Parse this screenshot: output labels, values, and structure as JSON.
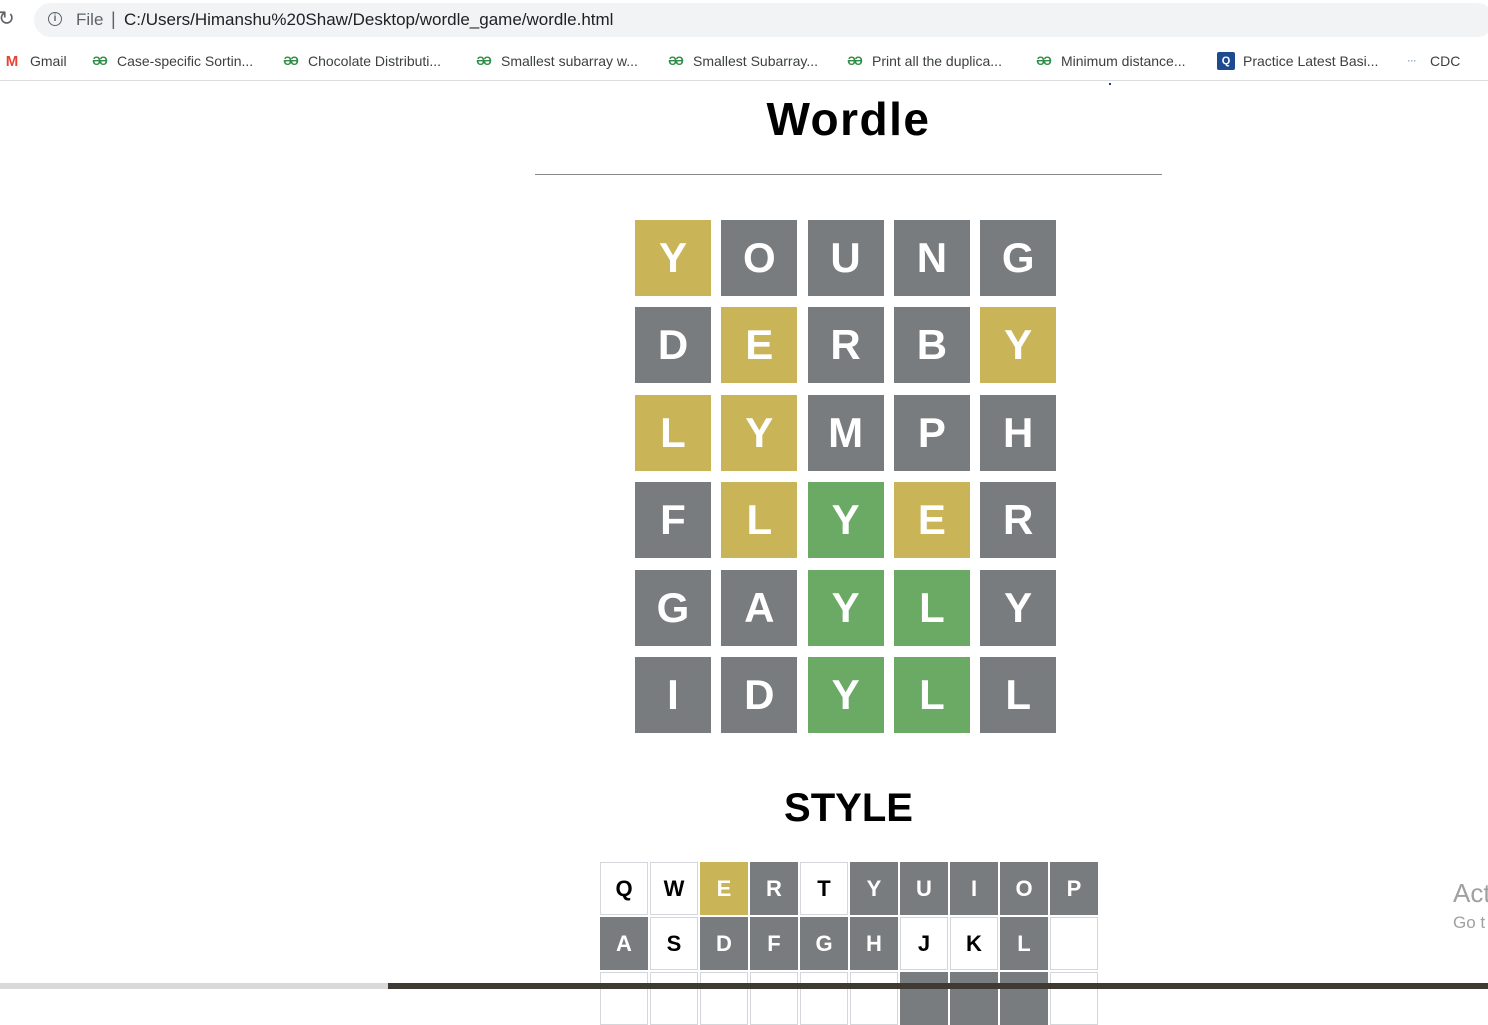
{
  "browser": {
    "file_label": "File",
    "separator": "|",
    "url": "C:/Users/Himanshu%20Shaw/Desktop/wordle_game/wordle.html",
    "bookmarks": [
      {
        "label": "Gmail",
        "icon": "gmail-icon"
      },
      {
        "label": "Case-specific Sortin...",
        "icon": "geeksforgeeks-icon"
      },
      {
        "label": "Chocolate Distributi...",
        "icon": "geeksforgeeks-icon"
      },
      {
        "label": "Smallest subarray w...",
        "icon": "geeksforgeeks-icon"
      },
      {
        "label": "Smallest Subarray...",
        "icon": "geeksforgeeks-icon"
      },
      {
        "label": "Print all the duplica...",
        "icon": "geeksforgeeks-icon"
      },
      {
        "label": "Minimum distance...",
        "icon": "geeksforgeeks-icon"
      },
      {
        "label": "Practice Latest Basi...",
        "icon": "practice-icon"
      },
      {
        "label": "CDC",
        "icon": "cdc-icon"
      }
    ]
  },
  "page": {
    "title": "Wordle",
    "answer": "STYLE"
  },
  "colors": {
    "absent": "#787c7e",
    "present": "#c9b458",
    "correct": "#6aaa64"
  },
  "board": [
    [
      {
        "l": "Y",
        "s": "present"
      },
      {
        "l": "O",
        "s": "absent"
      },
      {
        "l": "U",
        "s": "absent"
      },
      {
        "l": "N",
        "s": "absent"
      },
      {
        "l": "G",
        "s": "absent"
      }
    ],
    [
      {
        "l": "D",
        "s": "absent"
      },
      {
        "l": "E",
        "s": "present"
      },
      {
        "l": "R",
        "s": "absent"
      },
      {
        "l": "B",
        "s": "absent"
      },
      {
        "l": "Y",
        "s": "present"
      }
    ],
    [
      {
        "l": "L",
        "s": "present"
      },
      {
        "l": "Y",
        "s": "present"
      },
      {
        "l": "M",
        "s": "absent"
      },
      {
        "l": "P",
        "s": "absent"
      },
      {
        "l": "H",
        "s": "absent"
      }
    ],
    [
      {
        "l": "F",
        "s": "absent"
      },
      {
        "l": "L",
        "s": "present"
      },
      {
        "l": "Y",
        "s": "correct"
      },
      {
        "l": "E",
        "s": "present"
      },
      {
        "l": "R",
        "s": "absent"
      }
    ],
    [
      {
        "l": "G",
        "s": "absent"
      },
      {
        "l": "A",
        "s": "absent"
      },
      {
        "l": "Y",
        "s": "correct"
      },
      {
        "l": "L",
        "s": "correct"
      },
      {
        "l": "Y",
        "s": "absent"
      }
    ],
    [
      {
        "l": "I",
        "s": "absent"
      },
      {
        "l": "D",
        "s": "absent"
      },
      {
        "l": "Y",
        "s": "correct"
      },
      {
        "l": "L",
        "s": "correct"
      },
      {
        "l": "L",
        "s": "absent"
      }
    ]
  ],
  "keyboard": [
    [
      {
        "l": "Q",
        "s": "unused"
      },
      {
        "l": "W",
        "s": "unused"
      },
      {
        "l": "E",
        "s": "present"
      },
      {
        "l": "R",
        "s": "absent"
      },
      {
        "l": "T",
        "s": "unused"
      },
      {
        "l": "Y",
        "s": "absent"
      },
      {
        "l": "U",
        "s": "absent"
      },
      {
        "l": "I",
        "s": "absent"
      },
      {
        "l": "O",
        "s": "absent"
      },
      {
        "l": "P",
        "s": "absent"
      }
    ],
    [
      {
        "l": "A",
        "s": "absent"
      },
      {
        "l": "S",
        "s": "unused"
      },
      {
        "l": "D",
        "s": "absent"
      },
      {
        "l": "F",
        "s": "absent"
      },
      {
        "l": "G",
        "s": "absent"
      },
      {
        "l": "H",
        "s": "absent"
      },
      {
        "l": "J",
        "s": "unused"
      },
      {
        "l": "K",
        "s": "unused"
      },
      {
        "l": "L",
        "s": "absent"
      },
      {
        "l": "",
        "s": "blank"
      }
    ],
    [
      {
        "l": "",
        "s": "blank"
      },
      {
        "l": "",
        "s": "blank"
      },
      {
        "l": "",
        "s": "blank"
      },
      {
        "l": "",
        "s": "blank"
      },
      {
        "l": "",
        "s": "blank"
      },
      {
        "l": "",
        "s": "blank"
      },
      {
        "l": "",
        "s": "absent"
      },
      {
        "l": "",
        "s": "absent"
      },
      {
        "l": "",
        "s": "absent"
      },
      {
        "l": "",
        "s": "blank"
      }
    ]
  ],
  "watermark": {
    "line1": "Act",
    "line2": "Go t"
  }
}
